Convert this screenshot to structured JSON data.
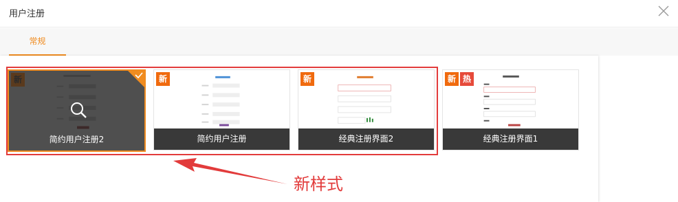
{
  "dialog": {
    "title": "用户注册"
  },
  "tabs": [
    {
      "label": "常规"
    }
  ],
  "templates": [
    {
      "caption": "简约用户注册2",
      "badges": [
        "新"
      ],
      "selected": true
    },
    {
      "caption": "简约用户注册",
      "badges": [
        "新"
      ],
      "selected": false
    },
    {
      "caption": "经典注册界面2",
      "badges": [
        "新"
      ],
      "selected": false
    },
    {
      "caption": "经典注册界面1",
      "badges": [
        "新",
        "热"
      ],
      "selected": false
    }
  ],
  "annotation": {
    "text": "新样式",
    "color": "#e23b3b"
  },
  "colors": {
    "accent": "#f08c20",
    "badge_new": "#f06a0e",
    "badge_hot": "#e64a3a"
  }
}
